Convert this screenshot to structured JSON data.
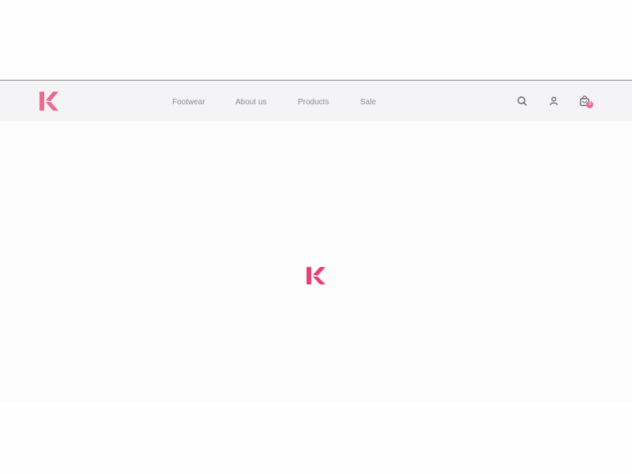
{
  "header": {
    "logo_icon": "k-logo-icon",
    "brand_color": "#ec6a8f",
    "nav": [
      {
        "label": "Footwear"
      },
      {
        "label": "About us"
      },
      {
        "label": "Products"
      },
      {
        "label": "Sale"
      }
    ],
    "actions": {
      "search_icon": "search-icon",
      "account_icon": "user-icon",
      "cart_icon": "shopping-bag-icon",
      "cart_count": "3"
    }
  },
  "loader": {
    "logo_icon": "k-logo-icon",
    "color": "#e8407a"
  }
}
